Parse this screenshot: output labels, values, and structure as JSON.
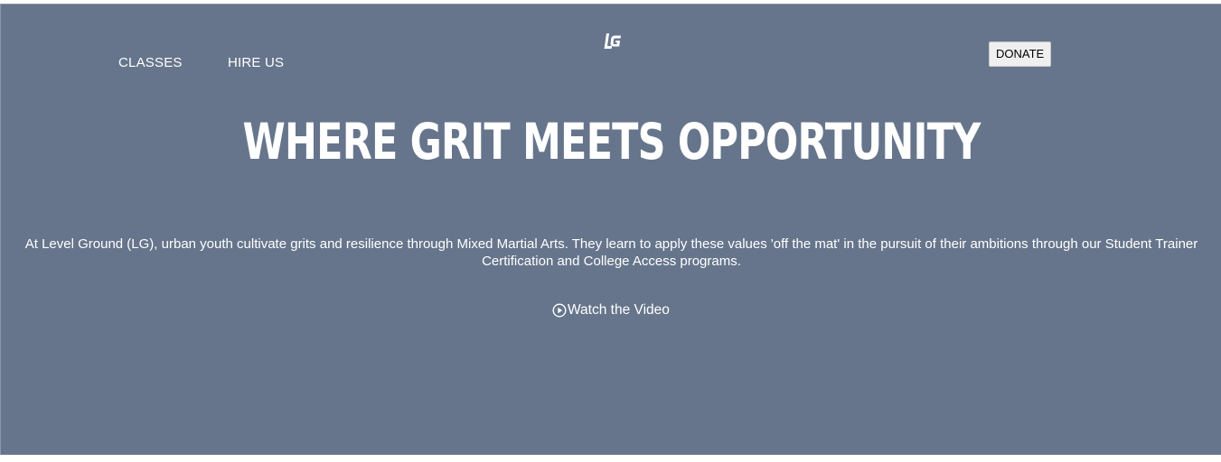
{
  "nav": {
    "classes_label": "CLASSES",
    "hire_label": "HIRE US",
    "logo_text": "LG",
    "donate_label": "DONATE"
  },
  "hero": {
    "headline": "WHERE GRIT MEETS OPPORTUNITY",
    "description": "At Level Ground (LG), urban youth cultivate grits and resilience through Mixed Martial Arts. They learn to apply these values 'off the mat' in the pursuit of their ambitions through our Student Trainer Certification and College Access programs.",
    "video_label": "Watch the Video",
    "video_icon": "play-circle-icon"
  },
  "colors": {
    "hero_background": "#66758b",
    "text": "#ffffff",
    "button_background": "#efefef"
  }
}
